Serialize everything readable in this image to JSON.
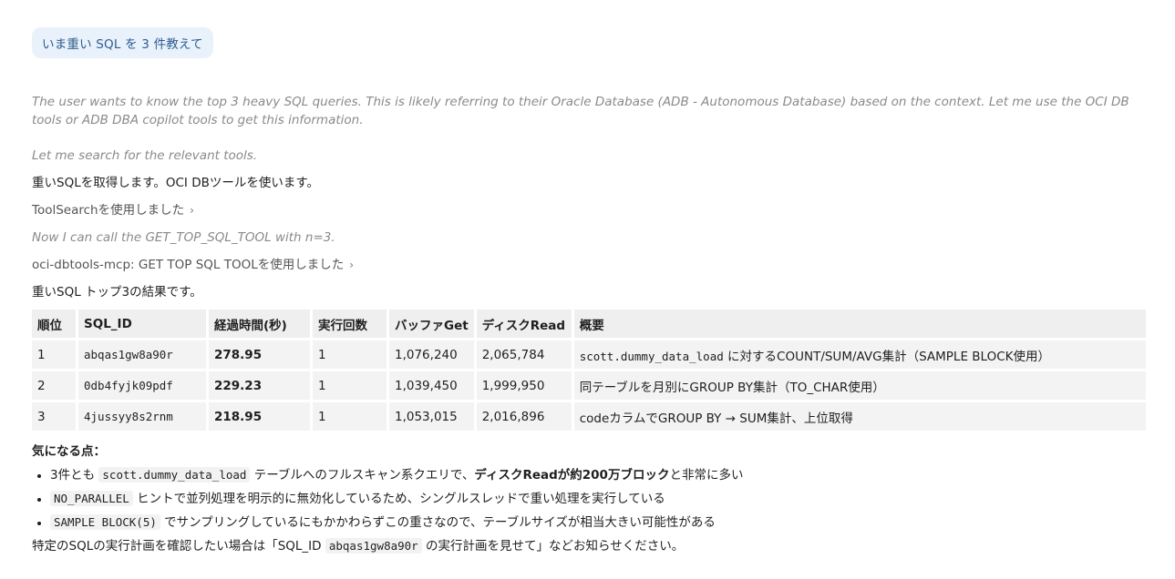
{
  "user_message": "いま重い SQL を 3 件教えて",
  "thinking_1": "The user wants to know the top 3 heavy SQL queries. This is likely referring to their Oracle Database (ADB - Autonomous Database) based on the context. Let me use the OCI DB tools or ADB DBA copilot tools to get this information.",
  "thinking_2": "Let me search for the relevant tools.",
  "reply_intro": "重いSQLを取得します。OCI DBツールを使います。",
  "tool_search": "ToolSearchを使用しました",
  "thinking_3": "Now I can call the GET_TOP_SQL_TOOL with n=3.",
  "tool_top_sql": "oci-dbtools-mcp: GET TOP SQL TOOLを使用しました",
  "results_intro": "重いSQL トップ3の結果です。",
  "table": {
    "headers": [
      "順位",
      "SQL_ID",
      "経過時間(秒)",
      "実行回数",
      "バッファGet",
      "ディスクRead",
      "概要"
    ],
    "rows": [
      {
        "rank": "1",
        "sql_id": "abqas1gw8a90r",
        "elapsed": "278.95",
        "executions": "1",
        "buffer_gets": "1,076,240",
        "disk_reads": "2,065,784",
        "summary_code": "scott.dummy_data_load",
        "summary_text": " に対するCOUNT/SUM/AVG集計（SAMPLE BLOCK使用）"
      },
      {
        "rank": "2",
        "sql_id": "0db4fyjk09pdf",
        "elapsed": "229.23",
        "executions": "1",
        "buffer_gets": "1,039,450",
        "disk_reads": "1,999,950",
        "summary_code": "",
        "summary_text": "同テーブルを月別にGROUP BY集計（TO_CHAR使用）"
      },
      {
        "rank": "3",
        "sql_id": "4jussyy8s2rnm",
        "elapsed": "218.95",
        "executions": "1",
        "buffer_gets": "1,053,015",
        "disk_reads": "2,016,896",
        "summary_code": "",
        "summary_text": "codeカラムでGROUP BY → SUM集計、上位取得"
      }
    ]
  },
  "notes_heading": "気になる点：",
  "notes": [
    {
      "pre": "3件とも ",
      "code": "scott.dummy_data_load",
      "mid": " テーブルへのフルスキャン系クエリで、",
      "bold": "ディスクReadが約200万ブロック",
      "post": "と非常に多い"
    },
    {
      "pre": "",
      "code": "NO_PARALLEL",
      "mid": " ヒントで並列処理を明示的に無効化しているため、シングルスレッドで重い処理を実行している",
      "bold": "",
      "post": ""
    },
    {
      "pre": "",
      "code": "SAMPLE BLOCK(5)",
      "mid": " でサンプリングしているにもかかわらずこの重さなので、テーブルサイズが相当大きい可能性がある",
      "bold": "",
      "post": ""
    }
  ],
  "closing": {
    "pre": "特定のSQLの実行計画を確認したい場合は「SQL_ID ",
    "code": "abqas1gw8a90r",
    "post": " の実行計画を見せて」などお知らせください。"
  },
  "icons": {
    "chevron": "chevron-right-icon"
  }
}
